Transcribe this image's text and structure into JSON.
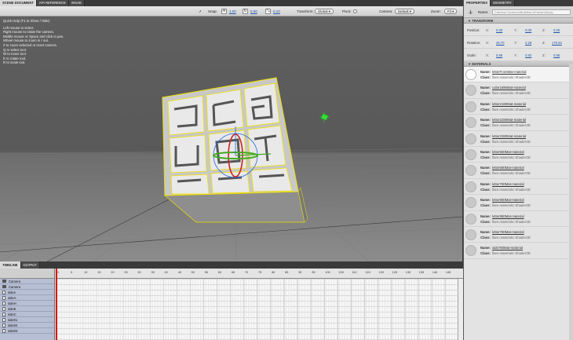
{
  "tabs": [
    "SCENE DOCUMENT",
    "API REFERENCE",
    "WGAE"
  ],
  "toolbar": {
    "snap_label": "Snap:",
    "snap_move": "1.00",
    "snap_rotate": "5.00",
    "snap_scale": "0.10",
    "transform_label": "Transform:",
    "transform_value": "Global ▾",
    "pivot_label": "Pivot:",
    "camera_label": "Camera:",
    "camera_value": "Default ▾",
    "zoom_label": "Zoom:",
    "zoom_value": "Fit ▾"
  },
  "help": {
    "title": "Quick Help (F1 to Show / Hide)",
    "lines": [
      "Left mouse to select.",
      "Right mouse to rotate the camera.",
      "Middle mouse or Space and click to pan.",
      "Wheel mouse to zoom in / out.",
      "Z to zoom selected or reset camera.",
      "Q to select tool.",
      "W to move tool.",
      "E to rotate tool.",
      "R to scale tool."
    ]
  },
  "timeline": {
    "tabs": [
      "TIMELINE",
      "OUTPUT"
    ],
    "ticks": [
      "1",
      "5",
      "10",
      "15",
      "20",
      "25",
      "30",
      "35",
      "40",
      "45",
      "50",
      "55",
      "60",
      "65",
      "70",
      "75",
      "80",
      "85",
      "90",
      "95",
      "100",
      "105",
      "110",
      "115",
      "120",
      "125",
      "130",
      "135",
      "140",
      "145"
    ],
    "layers": [
      "Camera",
      "Camera",
      "sides",
      "sideA",
      "sideH",
      "sideE",
      "sideC",
      "side01",
      "side02",
      "side03"
    ]
  },
  "panel": {
    "tabs": [
      "PROPERTIES",
      "GEOMETRY"
    ],
    "name_label": "Name:",
    "name_value": "Camera.Camera.kBuildbox.kFactorUBody",
    "transform_title": "▼ TRANSFORM",
    "position": {
      "label": "Position:",
      "x": "0.00",
      "y": "0.00",
      "z": "0.00"
    },
    "rotation": {
      "label": "Rotation:",
      "x": "28.70",
      "y": "4.28",
      "z": "175.94"
    },
    "scale": {
      "label": "Scale:",
      "x": "0.96",
      "y": "0.92",
      "z": "0.95"
    },
    "axes": [
      "X:",
      "Y:",
      "Z:"
    ],
    "materials_title": "▼ MATERIALS",
    "mat_name_key": "Name:",
    "mat_class_key": "Class:",
    "materials": [
      {
        "name": "letterFrontMat-material",
        "class": "flare.materials::Shader3D"
      },
      {
        "name": "cube1696Mat-material",
        "class": "flare.materials::Shader3D"
      },
      {
        "name": "letter2180Mat-material",
        "class": "flare.materials::Shader3D"
      },
      {
        "name": "letter2280Mat-material",
        "class": "flare.materials::Shader3D"
      },
      {
        "name": "letter2380Mat-material",
        "class": "flare.materials::Shader3D"
      },
      {
        "name": "letter580Mat-material",
        "class": "flare.materials::Shader3D"
      },
      {
        "name": "letter680Mat-material",
        "class": "flare.materials::Shader3D"
      },
      {
        "name": "letter780Mat-material",
        "class": "flare.materials::Shader3D"
      },
      {
        "name": "letter880Mat-material",
        "class": "flare.materials::Shader3D"
      },
      {
        "name": "letter980Mat-material",
        "class": "flare.materials::Shader3D"
      },
      {
        "name": "letter780Mat-material",
        "class": "flare.materials::Shader3D"
      },
      {
        "name": "side780Mat-material",
        "class": "flare.materials::Shader3D"
      }
    ]
  },
  "colors": {
    "playhead": "#dd1111",
    "selection": "#f0e000",
    "gizmo_x": "#cc2222",
    "gizmo_y": "#44aa22",
    "gizmo_z": "#2266dd"
  }
}
